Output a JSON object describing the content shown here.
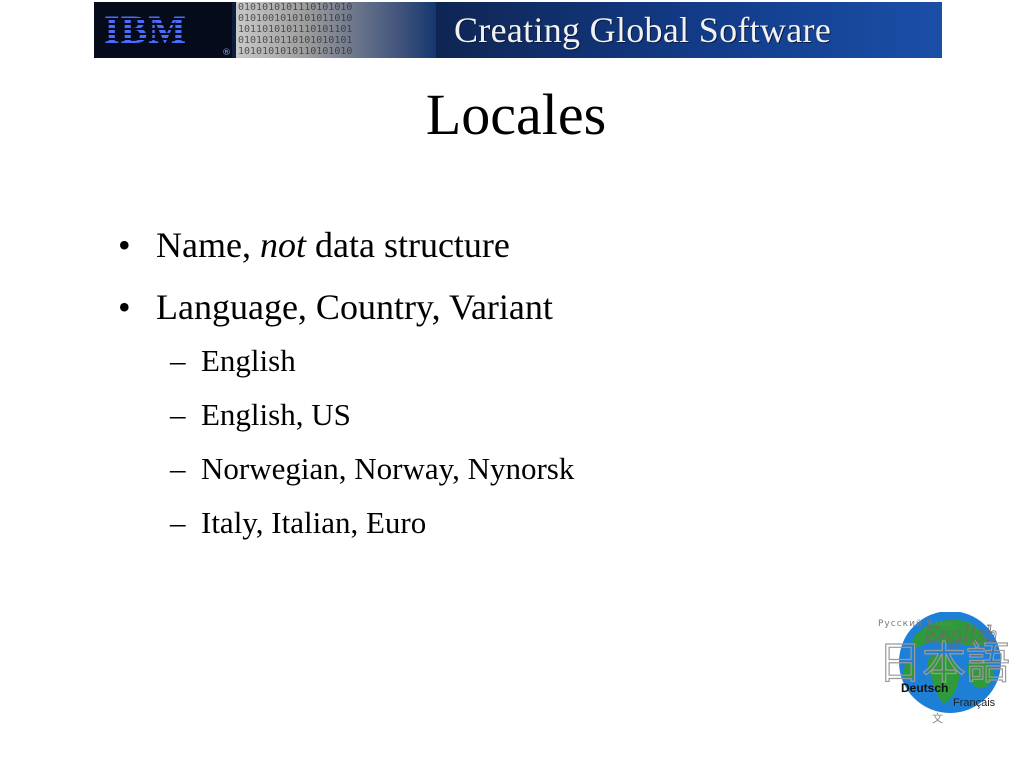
{
  "banner": {
    "logo_text": "IBM",
    "logo_reg": "®",
    "binary_lines": [
      "0101010101110101010",
      "0101001010101011010",
      "1011010101110101101",
      "0101010110101010101",
      "1010101010110101010"
    ],
    "title": "Creating Global Software"
  },
  "slide": {
    "title": "Locales",
    "bullets": [
      {
        "marker": "•",
        "text_before": "Name, ",
        "text_emphasis": "not",
        "text_after": " data structure"
      },
      {
        "marker": "•",
        "text": "Language, Country, Variant"
      }
    ],
    "sub_bullets": [
      {
        "marker": "–",
        "text": "English"
      },
      {
        "marker": "–",
        "text": "English, US"
      },
      {
        "marker": "–",
        "text": "Norwegian, Norway, Nynorsk"
      },
      {
        "marker": "–",
        "text": "Italy, Italian, Euro"
      }
    ]
  },
  "globe_logo": {
    "top_text": "Русский Язык",
    "english": "English",
    "kanji": "日本語",
    "deutsch": "Deutsch",
    "francais": "Français",
    "small_char": "文",
    "colors": {
      "ocean": "#1e7fd6",
      "land": "#2f9a3a",
      "gray_text": "#8a8a8a"
    }
  }
}
